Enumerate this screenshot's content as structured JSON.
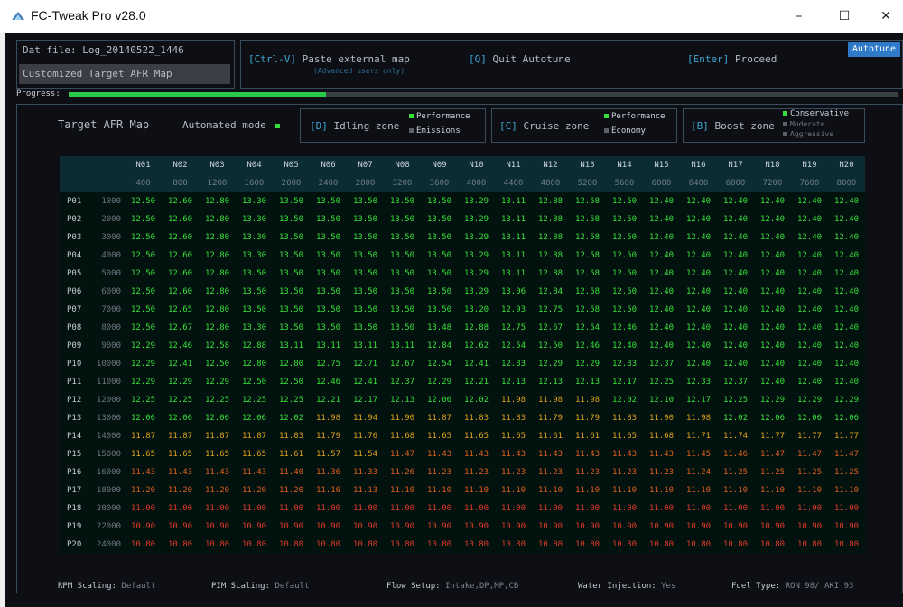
{
  "window": {
    "title": "FC-Tweak Pro v28.0",
    "min": "–",
    "max": "☐",
    "close": "✕"
  },
  "top": {
    "dat_file": "Dat file: Log_20140522_1446",
    "target_label": "Customized Target AFR Map",
    "ctrlv": "[Ctrl-V]",
    "paste": " Paste external map",
    "paste_sub": "(Advanced users only)",
    "quit_key": "[Q]",
    "quit": " Quit Autotune",
    "enter_key": "[Enter]",
    "proceed": " Proceed",
    "badge": "Autotune"
  },
  "progress": {
    "label": "Progress:",
    "fraction": 0.31
  },
  "modes": {
    "target": "Target AFR Map",
    "auto": "Automated mode",
    "idle_key": "[D]",
    "idle": " Idling zone",
    "idle_opts": [
      "Performance",
      "Emissions"
    ],
    "cruise_key": "[C]",
    "cruise": " Cruise zone",
    "cruise_opts": [
      "Performance",
      "Economy"
    ],
    "boost_key": "[B]",
    "boost": " Boost zone",
    "boost_opts": [
      "Conservative",
      "Moderate",
      "Aggressive"
    ]
  },
  "table": {
    "cols": [
      "N01",
      "N02",
      "N03",
      "N04",
      "N05",
      "N06",
      "N07",
      "N08",
      "N09",
      "N10",
      "N11",
      "N12",
      "N13",
      "N14",
      "N15",
      "N16",
      "N17",
      "N18",
      "N19",
      "N20"
    ],
    "colvals": [
      "400",
      "800",
      "1200",
      "1600",
      "2000",
      "2400",
      "2800",
      "3200",
      "3600",
      "4000",
      "4400",
      "4800",
      "5200",
      "5600",
      "6000",
      "6400",
      "6800",
      "7200",
      "7600",
      "8000"
    ],
    "rows": [
      {
        "p": "P01",
        "rpm": "1000",
        "v": [
          "12.50",
          "12.60",
          "12.80",
          "13.30",
          "13.50",
          "13.50",
          "13.50",
          "13.50",
          "13.50",
          "13.29",
          "13.11",
          "12.88",
          "12.58",
          "12.50",
          "12.40",
          "12.40",
          "12.40",
          "12.40",
          "12.40",
          "12.40"
        ]
      },
      {
        "p": "P02",
        "rpm": "2000",
        "v": [
          "12.50",
          "12.60",
          "12.80",
          "13.30",
          "13.50",
          "13.50",
          "13.50",
          "13.50",
          "13.50",
          "13.29",
          "13.11",
          "12.88",
          "12.58",
          "12.50",
          "12.40",
          "12.40",
          "12.40",
          "12.40",
          "12.40",
          "12.40"
        ]
      },
      {
        "p": "P03",
        "rpm": "3000",
        "v": [
          "12.50",
          "12.60",
          "12.80",
          "13.30",
          "13.50",
          "13.50",
          "13.50",
          "13.50",
          "13.50",
          "13.29",
          "13.11",
          "12.88",
          "12.58",
          "12.50",
          "12.40",
          "12.40",
          "12.40",
          "12.40",
          "12.40",
          "12.40"
        ]
      },
      {
        "p": "P04",
        "rpm": "4000",
        "v": [
          "12.50",
          "12.60",
          "12.80",
          "13.30",
          "13.50",
          "13.50",
          "13.50",
          "13.50",
          "13.50",
          "13.29",
          "13.11",
          "12.88",
          "12.58",
          "12.50",
          "12.40",
          "12.40",
          "12.40",
          "12.40",
          "12.40",
          "12.40"
        ]
      },
      {
        "p": "P05",
        "rpm": "5000",
        "v": [
          "12.50",
          "12.60",
          "12.80",
          "13.50",
          "13.50",
          "13.50",
          "13.50",
          "13.50",
          "13.50",
          "13.29",
          "13.11",
          "12.88",
          "12.58",
          "12.50",
          "12.40",
          "12.40",
          "12.40",
          "12.40",
          "12.40",
          "12.40"
        ]
      },
      {
        "p": "P06",
        "rpm": "6000",
        "v": [
          "12.50",
          "12.60",
          "12.80",
          "13.50",
          "13.50",
          "13.50",
          "13.50",
          "13.50",
          "13.50",
          "13.29",
          "13.06",
          "12.84",
          "12.58",
          "12.50",
          "12.40",
          "12.40",
          "12.40",
          "12.40",
          "12.40",
          "12.40"
        ]
      },
      {
        "p": "P07",
        "rpm": "7000",
        "v": [
          "12.50",
          "12.65",
          "12.80",
          "13.50",
          "13.50",
          "13.50",
          "13.50",
          "13.50",
          "13.50",
          "13.20",
          "12.93",
          "12.75",
          "12.58",
          "12.50",
          "12.40",
          "12.40",
          "12.40",
          "12.40",
          "12.40",
          "12.40"
        ]
      },
      {
        "p": "P08",
        "rpm": "8000",
        "v": [
          "12.50",
          "12.67",
          "12.80",
          "13.30",
          "13.50",
          "13.50",
          "13.50",
          "13.50",
          "13.48",
          "12.88",
          "12.75",
          "12.67",
          "12.54",
          "12.46",
          "12.40",
          "12.40",
          "12.40",
          "12.40",
          "12.40",
          "12.40"
        ]
      },
      {
        "p": "P09",
        "rpm": "9000",
        "v": [
          "12.29",
          "12.46",
          "12.58",
          "12.88",
          "13.11",
          "13.11",
          "13.11",
          "13.11",
          "12.84",
          "12.62",
          "12.54",
          "12.50",
          "12.46",
          "12.40",
          "12.40",
          "12.40",
          "12.40",
          "12.40",
          "12.40",
          "12.40"
        ]
      },
      {
        "p": "P10",
        "rpm": "10000",
        "v": [
          "12.29",
          "12.41",
          "12.50",
          "12.80",
          "12.80",
          "12.75",
          "12.71",
          "12.67",
          "12.54",
          "12.41",
          "12.33",
          "12.29",
          "12.29",
          "12.33",
          "12.37",
          "12.40",
          "12.40",
          "12.40",
          "12.40",
          "12.40"
        ]
      },
      {
        "p": "P11",
        "rpm": "11000",
        "v": [
          "12.29",
          "12.29",
          "12.29",
          "12.50",
          "12.50",
          "12.46",
          "12.41",
          "12.37",
          "12.29",
          "12.21",
          "12.13",
          "12.13",
          "12.13",
          "12.17",
          "12.25",
          "12.33",
          "12.37",
          "12.40",
          "12.40",
          "12.40"
        ]
      },
      {
        "p": "P12",
        "rpm": "12000",
        "v": [
          "12.25",
          "12.25",
          "12.25",
          "12.25",
          "12.25",
          "12.21",
          "12.17",
          "12.13",
          "12.06",
          "12.02",
          "11.98",
          "11.98",
          "11.98",
          "12.02",
          "12.10",
          "12.17",
          "12.25",
          "12.29",
          "12.29",
          "12.29"
        ]
      },
      {
        "p": "P13",
        "rpm": "13000",
        "v": [
          "12.06",
          "12.06",
          "12.06",
          "12.06",
          "12.02",
          "11.98",
          "11.94",
          "11.90",
          "11.87",
          "11.83",
          "11.83",
          "11.79",
          "11.79",
          "11.83",
          "11.90",
          "11.98",
          "12.02",
          "12.06",
          "12.06",
          "12.06"
        ]
      },
      {
        "p": "P14",
        "rpm": "14000",
        "v": [
          "11.87",
          "11.87",
          "11.87",
          "11.87",
          "11.83",
          "11.79",
          "11.76",
          "11.68",
          "11.65",
          "11.65",
          "11.65",
          "11.61",
          "11.61",
          "11.65",
          "11.68",
          "11.71",
          "11.74",
          "11.77",
          "11.77",
          "11.77"
        ]
      },
      {
        "p": "P15",
        "rpm": "15000",
        "v": [
          "11.65",
          "11.65",
          "11.65",
          "11.65",
          "11.61",
          "11.57",
          "11.54",
          "11.47",
          "11.43",
          "11.43",
          "11.43",
          "11.43",
          "11.43",
          "11.43",
          "11.43",
          "11.45",
          "11.46",
          "11.47",
          "11.47",
          "11.47"
        ]
      },
      {
        "p": "P16",
        "rpm": "16000",
        "v": [
          "11.43",
          "11.43",
          "11.43",
          "11.43",
          "11.40",
          "11.36",
          "11.33",
          "11.26",
          "11.23",
          "11.23",
          "11.23",
          "11.23",
          "11.23",
          "11.23",
          "11.23",
          "11.24",
          "11.25",
          "11.25",
          "11.25",
          "11.25"
        ]
      },
      {
        "p": "P17",
        "rpm": "18000",
        "v": [
          "11.20",
          "11.20",
          "11.20",
          "11.20",
          "11.20",
          "11.16",
          "11.13",
          "11.10",
          "11.10",
          "11.10",
          "11.10",
          "11.10",
          "11.10",
          "11.10",
          "11.10",
          "11.10",
          "11.10",
          "11.10",
          "11.10",
          "11.10"
        ]
      },
      {
        "p": "P18",
        "rpm": "20000",
        "v": [
          "11.00",
          "11.00",
          "11.00",
          "11.00",
          "11.00",
          "11.00",
          "11.00",
          "11.00",
          "11.00",
          "11.00",
          "11.00",
          "11.00",
          "11.00",
          "11.00",
          "11.00",
          "11.00",
          "11.00",
          "11.00",
          "11.00",
          "11.00"
        ]
      },
      {
        "p": "P19",
        "rpm": "22000",
        "v": [
          "10.90",
          "10.90",
          "10.90",
          "10.90",
          "10.90",
          "10.90",
          "10.90",
          "10.90",
          "10.90",
          "10.90",
          "10.90",
          "10.90",
          "10.90",
          "10.90",
          "10.90",
          "10.90",
          "10.90",
          "10.90",
          "10.90",
          "10.90"
        ]
      },
      {
        "p": "P20",
        "rpm": "24000",
        "v": [
          "10.80",
          "10.80",
          "10.80",
          "10.80",
          "10.80",
          "10.80",
          "10.80",
          "10.80",
          "10.80",
          "10.80",
          "10.80",
          "10.80",
          "10.80",
          "10.80",
          "10.80",
          "10.80",
          "10.80",
          "10.80",
          "10.80",
          "10.80"
        ]
      }
    ]
  },
  "footer": {
    "rpm_label": "RPM Scaling:",
    "rpm_val": " Default",
    "pim_label": "PIM Scaling:",
    "pim_val": " Default",
    "flow_label": "Flow Setup:",
    "flow_val": " Intake,DP,MP,CB",
    "water_label": "Water Injection:",
    "water_val": " Yes",
    "fuel_label": "Fuel Type:",
    "fuel_val": " RON 98/ AKI 93"
  },
  "colors": {
    "accent": "#3fa7d6",
    "green": "#39e03a",
    "orange": "#e0a21a",
    "red": "#e23a2a"
  }
}
